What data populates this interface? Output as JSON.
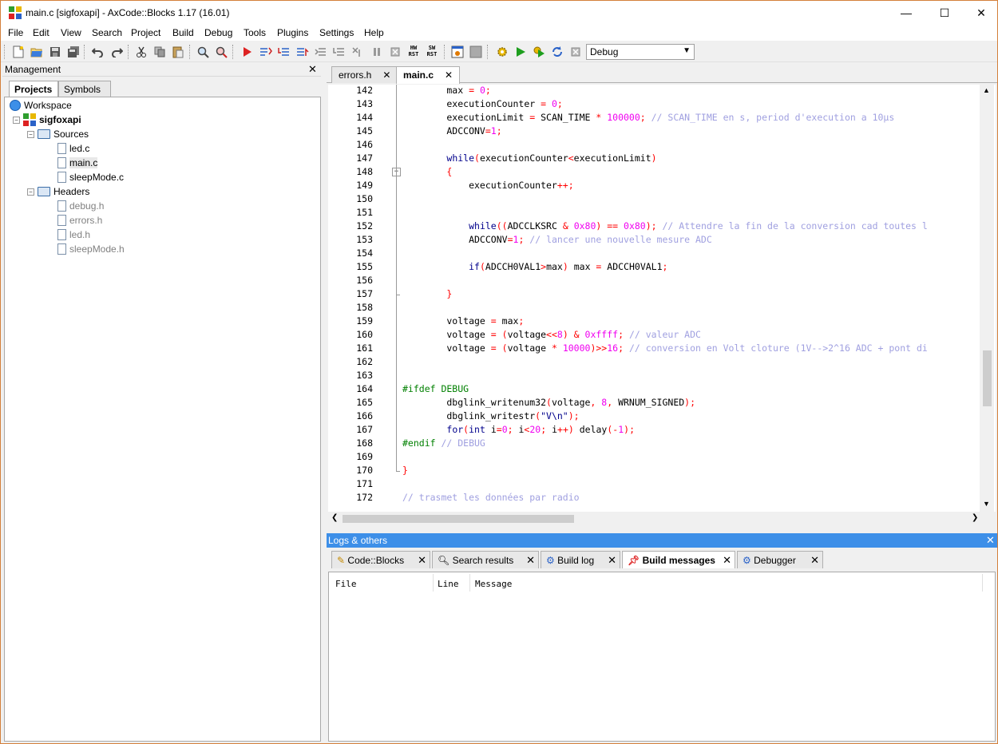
{
  "window": {
    "title": "main.c [sigfoxapi] - AxCode::Blocks 1.17 (16.01)",
    "controls": {
      "minimize": "—",
      "maximize": "☐",
      "close": "✕"
    }
  },
  "menu": [
    "File",
    "Edit",
    "View",
    "Search",
    "Project",
    "Build",
    "Debug",
    "Tools",
    "Plugins",
    "Settings",
    "Help"
  ],
  "toolbar": {
    "hw_rst": "HW\nRST",
    "sw_rst": "SW\nRST",
    "build_target": "Debug"
  },
  "management": {
    "title": "Management",
    "tabs": [
      "Projects",
      "Symbols"
    ],
    "tree": {
      "workspace": "Workspace",
      "project": "sigfoxapi",
      "sources_label": "Sources",
      "sources": [
        "led.c",
        "main.c",
        "sleepMode.c"
      ],
      "headers_label": "Headers",
      "headers": [
        "debug.h",
        "errors.h",
        "led.h",
        "sleepMode.h"
      ]
    }
  },
  "editor": {
    "tabs": [
      {
        "label": "errors.h"
      },
      {
        "label": "main.c",
        "active": true
      }
    ],
    "line_numbers": [
      "142",
      "143",
      "144",
      "145",
      "146",
      "147",
      "148",
      "149",
      "150",
      "151",
      "152",
      "153",
      "154",
      "155",
      "156",
      "157",
      "158",
      "159",
      "160",
      "161",
      "162",
      "163",
      "164",
      "165",
      "166",
      "167",
      "168",
      "169",
      "170",
      "171",
      "172"
    ],
    "lines": [
      [
        {
          "t": "        max ",
          "c": ""
        },
        {
          "t": "= ",
          "c": "op"
        },
        {
          "t": "0",
          "c": "num"
        },
        {
          "t": ";",
          "c": "op"
        }
      ],
      [
        {
          "t": "        executionCounter ",
          "c": ""
        },
        {
          "t": "= ",
          "c": "op"
        },
        {
          "t": "0",
          "c": "num"
        },
        {
          "t": ";",
          "c": "op"
        }
      ],
      [
        {
          "t": "        executionLimit ",
          "c": ""
        },
        {
          "t": "= ",
          "c": "op"
        },
        {
          "t": "SCAN_TIME ",
          "c": ""
        },
        {
          "t": "* ",
          "c": "op"
        },
        {
          "t": "100000",
          "c": "num"
        },
        {
          "t": "; ",
          "c": "op"
        },
        {
          "t": "// SCAN_TIME en s, period d'execution a 10µs",
          "c": "cm"
        }
      ],
      [
        {
          "t": "        ADCCONV",
          "c": ""
        },
        {
          "t": "=",
          "c": "op"
        },
        {
          "t": "1",
          "c": "num"
        },
        {
          "t": ";",
          "c": "op"
        }
      ],
      [
        {
          "t": "",
          "c": ""
        }
      ],
      [
        {
          "t": "        ",
          "c": ""
        },
        {
          "t": "while",
          "c": "kw"
        },
        {
          "t": "(",
          "c": "op"
        },
        {
          "t": "executionCounter",
          "c": ""
        },
        {
          "t": "<",
          "c": "op"
        },
        {
          "t": "executionLimit",
          "c": ""
        },
        {
          "t": ")",
          "c": "op"
        }
      ],
      [
        {
          "t": "        ",
          "c": ""
        },
        {
          "t": "{",
          "c": "op"
        }
      ],
      [
        {
          "t": "            executionCounter",
          "c": ""
        },
        {
          "t": "++;",
          "c": "op"
        }
      ],
      [
        {
          "t": "",
          "c": ""
        }
      ],
      [
        {
          "t": "",
          "c": ""
        }
      ],
      [
        {
          "t": "            ",
          "c": ""
        },
        {
          "t": "while",
          "c": "kw"
        },
        {
          "t": "((",
          "c": "op"
        },
        {
          "t": "ADCCLKSRC ",
          "c": ""
        },
        {
          "t": "& ",
          "c": "op"
        },
        {
          "t": "0x80",
          "c": "num"
        },
        {
          "t": ") == ",
          "c": "op"
        },
        {
          "t": "0x80",
          "c": "num"
        },
        {
          "t": "); ",
          "c": "op"
        },
        {
          "t": "// Attendre la fin de la conversion cad toutes l",
          "c": "cm"
        }
      ],
      [
        {
          "t": "            ADCCONV",
          "c": ""
        },
        {
          "t": "=",
          "c": "op"
        },
        {
          "t": "1",
          "c": "num"
        },
        {
          "t": "; ",
          "c": "op"
        },
        {
          "t": "// lancer une nouvelle mesure ADC",
          "c": "cm"
        }
      ],
      [
        {
          "t": "",
          "c": ""
        }
      ],
      [
        {
          "t": "            ",
          "c": ""
        },
        {
          "t": "if",
          "c": "kw"
        },
        {
          "t": "(",
          "c": "op"
        },
        {
          "t": "ADCCH0VAL1",
          "c": ""
        },
        {
          "t": ">",
          "c": "op"
        },
        {
          "t": "max",
          "c": ""
        },
        {
          "t": ") ",
          "c": "op"
        },
        {
          "t": "max ",
          "c": ""
        },
        {
          "t": "= ",
          "c": "op"
        },
        {
          "t": "ADCCH0VAL1",
          "c": ""
        },
        {
          "t": ";",
          "c": "op"
        }
      ],
      [
        {
          "t": "",
          "c": ""
        }
      ],
      [
        {
          "t": "        ",
          "c": ""
        },
        {
          "t": "}",
          "c": "op"
        }
      ],
      [
        {
          "t": "",
          "c": ""
        }
      ],
      [
        {
          "t": "        voltage ",
          "c": ""
        },
        {
          "t": "= ",
          "c": "op"
        },
        {
          "t": "max",
          "c": ""
        },
        {
          "t": ";",
          "c": "op"
        }
      ],
      [
        {
          "t": "        voltage ",
          "c": ""
        },
        {
          "t": "= (",
          "c": "op"
        },
        {
          "t": "voltage",
          "c": ""
        },
        {
          "t": "<<",
          "c": "op"
        },
        {
          "t": "8",
          "c": "num"
        },
        {
          "t": ") & ",
          "c": "op"
        },
        {
          "t": "0xffff",
          "c": "num"
        },
        {
          "t": "; ",
          "c": "op"
        },
        {
          "t": "// valeur ADC",
          "c": "cm"
        }
      ],
      [
        {
          "t": "        voltage ",
          "c": ""
        },
        {
          "t": "= (",
          "c": "op"
        },
        {
          "t": "voltage ",
          "c": ""
        },
        {
          "t": "* ",
          "c": "op"
        },
        {
          "t": "10000",
          "c": "num"
        },
        {
          "t": ")>>",
          "c": "op"
        },
        {
          "t": "16",
          "c": "num"
        },
        {
          "t": "; ",
          "c": "op"
        },
        {
          "t": "// conversion en Volt cloture (1V-->2^16 ADC + pont di",
          "c": "cm"
        }
      ],
      [
        {
          "t": "",
          "c": ""
        }
      ],
      [
        {
          "t": "",
          "c": ""
        }
      ],
      [
        {
          "t": "#ifdef DEBUG",
          "c": "pp"
        }
      ],
      [
        {
          "t": "        dbglink_writenum32",
          "c": ""
        },
        {
          "t": "(",
          "c": "op"
        },
        {
          "t": "voltage",
          "c": ""
        },
        {
          "t": ", ",
          "c": "op"
        },
        {
          "t": "8",
          "c": "num"
        },
        {
          "t": ", ",
          "c": "op"
        },
        {
          "t": "WRNUM_SIGNED",
          "c": ""
        },
        {
          "t": ");",
          "c": "op"
        }
      ],
      [
        {
          "t": "        dbglink_writestr",
          "c": ""
        },
        {
          "t": "(",
          "c": "op"
        },
        {
          "t": "\"V\\n\"",
          "c": "kwb"
        },
        {
          "t": ");",
          "c": "op"
        }
      ],
      [
        {
          "t": "        ",
          "c": ""
        },
        {
          "t": "for",
          "c": "kw"
        },
        {
          "t": "(",
          "c": "op"
        },
        {
          "t": "int ",
          "c": "kw"
        },
        {
          "t": "i",
          "c": ""
        },
        {
          "t": "=",
          "c": "op"
        },
        {
          "t": "0",
          "c": "num"
        },
        {
          "t": "; ",
          "c": "op"
        },
        {
          "t": "i",
          "c": ""
        },
        {
          "t": "<",
          "c": "op"
        },
        {
          "t": "20",
          "c": "num"
        },
        {
          "t": "; ",
          "c": "op"
        },
        {
          "t": "i",
          "c": ""
        },
        {
          "t": "++) ",
          "c": "op"
        },
        {
          "t": "delay",
          "c": ""
        },
        {
          "t": "(-",
          "c": "op"
        },
        {
          "t": "1",
          "c": "num"
        },
        {
          "t": ");",
          "c": "op"
        }
      ],
      [
        {
          "t": "#endif ",
          "c": "pp"
        },
        {
          "t": "// DEBUG",
          "c": "cm"
        }
      ],
      [
        {
          "t": "",
          "c": ""
        }
      ],
      [
        {
          "t": "}",
          "c": "op"
        }
      ],
      [
        {
          "t": "",
          "c": ""
        }
      ],
      [
        {
          "t": "// trasmet les données par radio",
          "c": "cm"
        }
      ]
    ]
  },
  "logs": {
    "title": "Logs & others",
    "tabs": [
      {
        "label": "Code::Blocks",
        "icon": "pencil-icon"
      },
      {
        "label": "Search results",
        "icon": "search-icon"
      },
      {
        "label": "Build log",
        "icon": "gear-icon"
      },
      {
        "label": "Build messages",
        "icon": "pin-icon",
        "active": true
      },
      {
        "label": "Debugger",
        "icon": "gear-icon"
      }
    ],
    "columns": [
      "File",
      "Line",
      "Message"
    ]
  }
}
